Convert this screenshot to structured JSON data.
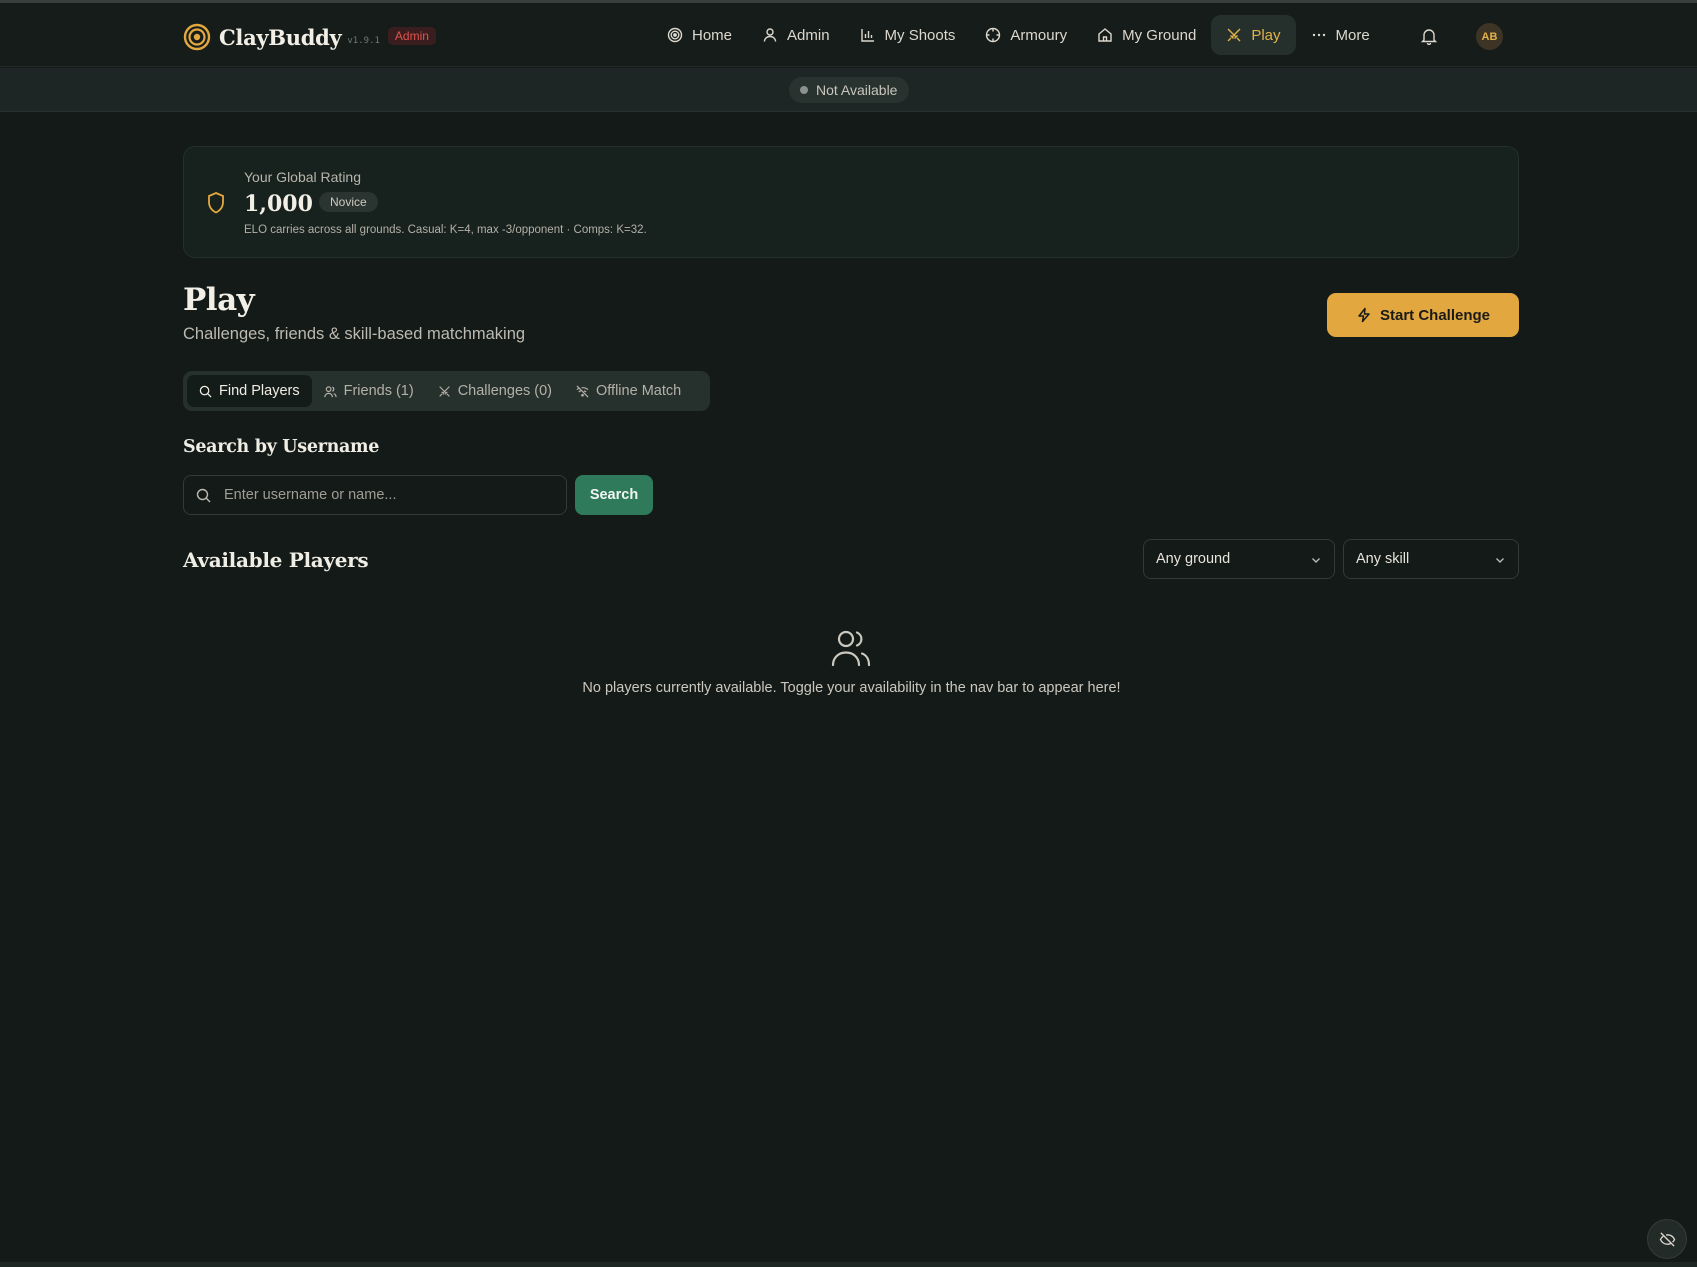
{
  "app": {
    "name": "ClayBuddy",
    "version": "v1.9.1",
    "badge": "Admin"
  },
  "nav": {
    "items": [
      {
        "label": "Home",
        "icon": "target-icon"
      },
      {
        "label": "Admin",
        "icon": "user-icon"
      },
      {
        "label": "My Shoots",
        "icon": "bar-chart-icon"
      },
      {
        "label": "Armoury",
        "icon": "crosshair-icon"
      },
      {
        "label": "My Ground",
        "icon": "home-icon"
      },
      {
        "label": "Play",
        "icon": "swords-icon",
        "active": true
      },
      {
        "label": "More",
        "icon": "ellipsis-icon"
      }
    ],
    "avatar_initials": "AB"
  },
  "availability": {
    "status": "Not Available"
  },
  "rating": {
    "label": "Your Global Rating",
    "value": "1,000",
    "tier": "Novice",
    "note": "ELO carries across all grounds. Casual: K=4, max -3/opponent · Comps: K=32."
  },
  "page": {
    "title": "Play",
    "subtitle": "Challenges, friends & skill-based matchmaking",
    "start_button": "Start Challenge"
  },
  "tabs": [
    {
      "label": "Find Players",
      "active": true
    },
    {
      "label": "Friends (1)"
    },
    {
      "label": "Challenges (0)"
    },
    {
      "label": "Offline Match"
    }
  ],
  "search": {
    "heading": "Search by Username",
    "placeholder": "Enter username or name...",
    "value": "",
    "button": "Search"
  },
  "players": {
    "heading": "Available Players",
    "ground_filter": "Any ground",
    "skill_filter": "Any skill",
    "empty_message": "No players currently available. Toggle your availability in the nav bar to appear here!"
  },
  "colors": {
    "background": "#131a18",
    "accent_gold": "#e2a83f",
    "accent_green": "#2e7a5b",
    "admin_red": "#e0524f"
  }
}
